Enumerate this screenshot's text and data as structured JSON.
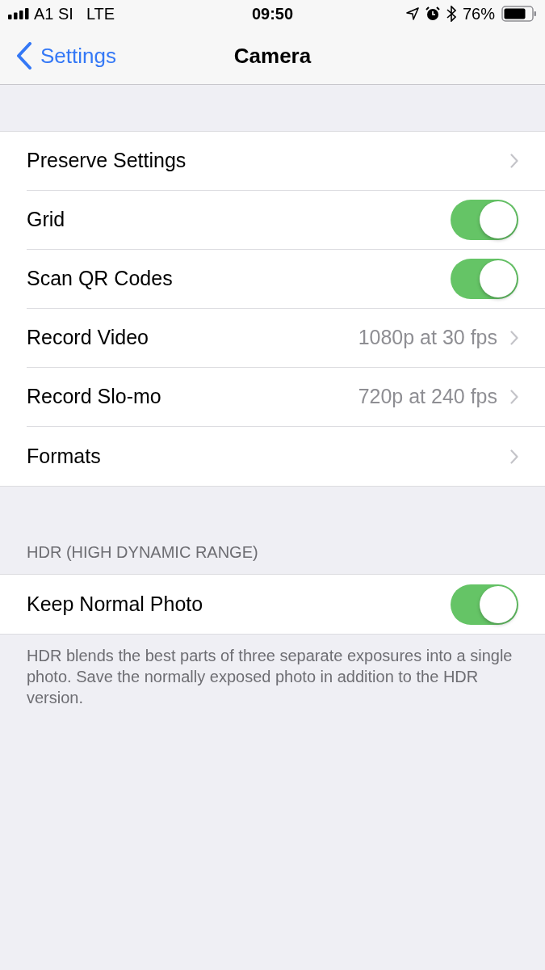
{
  "status_bar": {
    "carrier": "A1 SI",
    "network": "LTE",
    "time": "09:50",
    "battery": "76%"
  },
  "nav": {
    "back": "Settings",
    "title": "Camera"
  },
  "groups": [
    {
      "rows": [
        {
          "kind": "link",
          "label": "Preserve Settings"
        },
        {
          "kind": "toggle",
          "label": "Grid",
          "on": true
        },
        {
          "kind": "toggle",
          "label": "Scan QR Codes",
          "on": true
        },
        {
          "kind": "link",
          "label": "Record Video",
          "value": "1080p at 30 fps"
        },
        {
          "kind": "link",
          "label": "Record Slo-mo",
          "value": "720p at 240 fps"
        },
        {
          "kind": "link",
          "label": "Formats"
        }
      ]
    },
    {
      "header": "HDR (HIGH DYNAMIC RANGE)",
      "rows": [
        {
          "kind": "toggle",
          "label": "Keep Normal Photo",
          "on": true
        }
      ],
      "footer": "HDR blends the best parts of three separate exposures into a single photo. Save the normally exposed photo in addition to the HDR version."
    }
  ]
}
